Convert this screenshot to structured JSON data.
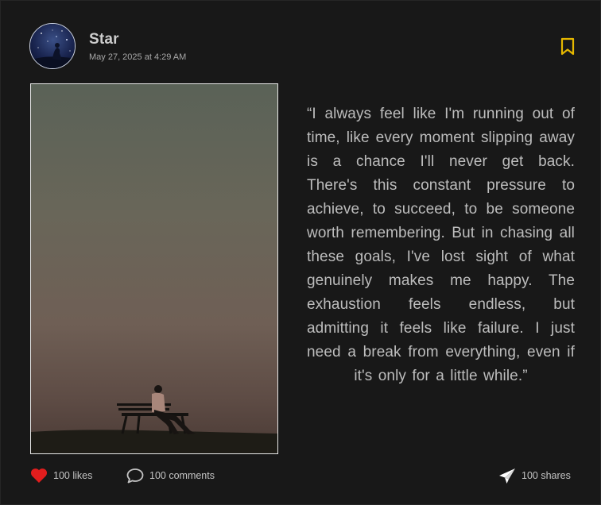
{
  "post": {
    "author": {
      "name": "Star",
      "avatar": "starry-night-avatar"
    },
    "date": "May 27, 2025 at 4:29 AM",
    "quote": "“I always feel like I'm running out of time, like every moment slipping away is a chance I'll never get back. There's this constant pressure to achieve, to succeed, to be someone worth remembering. But in chasing all these goals, I've lost sight of what genuinely makes me happy. The exhaustion feels endless, but admitting it feels like failure. I just need a break from everything, even if it's only for a little while.”",
    "image": "person-on-bench-at-dusk",
    "bookmark_icon": "bookmark-icon",
    "actions": {
      "likes": {
        "label": "100 likes",
        "icon": "heart-icon",
        "color": "#e21d1d"
      },
      "comments": {
        "label": "100 comments",
        "icon": "comment-icon"
      },
      "shares": {
        "label": "100 shares",
        "icon": "send-icon"
      }
    }
  },
  "colors": {
    "background": "#181818",
    "accent": "#e6b800",
    "text": "#bdbdbd"
  }
}
